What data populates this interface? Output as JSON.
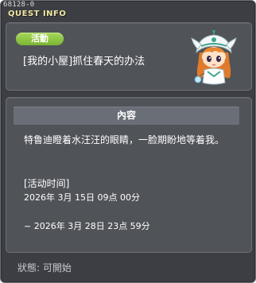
{
  "window": {
    "quest_id": "68128-0",
    "title": "QUEST INFO"
  },
  "quest": {
    "category": "活動",
    "name": "[我的小屋]抓住春天的办法",
    "npc_icon": "npc-elf-girl-icon"
  },
  "content": {
    "header": "內容",
    "description": "特鲁迪瞪着水汪汪的眼睛，一脸期盼地等着我。",
    "time_label": "[活动时间]",
    "time_start": "2026年  3月  15日  09点  00分",
    "time_end": "~  2026年  3月  28日  23点  59分"
  },
  "status": {
    "text": "狀態:  可開始"
  },
  "colors": {
    "window_bg": "#3c3e44",
    "panel_bg": "#505358",
    "badge_green": "#8cc63f",
    "title_yellow": "#f0e6a0",
    "header_bg": "#6a6e76"
  }
}
